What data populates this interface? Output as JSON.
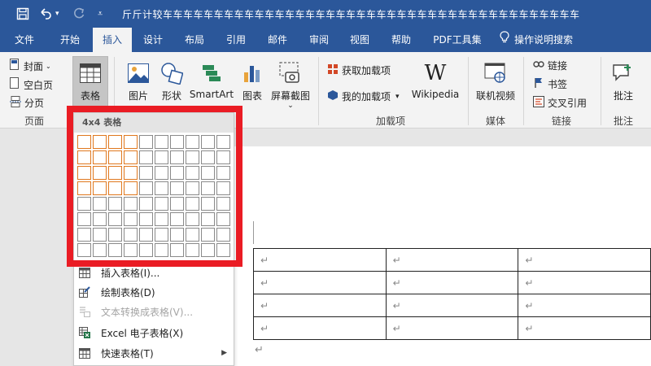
{
  "titlebar": {
    "title": "斤斤计较车车车车车车车车车车车车车车车车车车车车车车车车车车车车车车车车车车车车车车车车车"
  },
  "tabs": [
    {
      "label": "文件"
    },
    {
      "label": "开始"
    },
    {
      "label": "插入"
    },
    {
      "label": "设计"
    },
    {
      "label": "布局"
    },
    {
      "label": "引用"
    },
    {
      "label": "邮件"
    },
    {
      "label": "审阅"
    },
    {
      "label": "视图"
    },
    {
      "label": "帮助"
    },
    {
      "label": "PDF工具集"
    },
    {
      "label": "操作说明搜索"
    }
  ],
  "ribbon": {
    "pages": {
      "cover": "封面",
      "blank": "空白页",
      "break": "分页",
      "group": "页面"
    },
    "table": "表格",
    "picture": "图片",
    "shapes": "形状",
    "smartart": "SmartArt",
    "chart": "图表",
    "screenshot": "屏幕截图",
    "addins": {
      "get": "获取加载项",
      "mine": "我的加载项",
      "wikipedia": "Wikipedia",
      "group": "加载项"
    },
    "media": {
      "online_video": "联机视频",
      "group": "媒体"
    },
    "links": {
      "link": "链接",
      "bookmark": "书签",
      "crossref": "交叉引用",
      "group": "链接"
    },
    "comments": {
      "comment": "批注",
      "group": "批注"
    }
  },
  "dropdown": {
    "header": "4x4 表格",
    "grid": {
      "cols": 10,
      "rows": 8,
      "selected_cols": 4,
      "selected_rows": 4
    },
    "items": [
      {
        "label": "插入表格(I)...",
        "disabled": false
      },
      {
        "label": "绘制表格(D)",
        "disabled": false
      },
      {
        "label": "文本转换成表格(V)...",
        "disabled": true
      },
      {
        "label": "Excel 电子表格(X)",
        "disabled": false
      },
      {
        "label": "快速表格(T)",
        "disabled": false,
        "submenu": true
      }
    ]
  },
  "document": {
    "para_mark": "↵",
    "table_rows": 4,
    "table_cols": 3
  },
  "colors": {
    "brand": "#2b579a",
    "highlight_frame": "#ea1c24",
    "grid_selected": "#e0781e"
  }
}
